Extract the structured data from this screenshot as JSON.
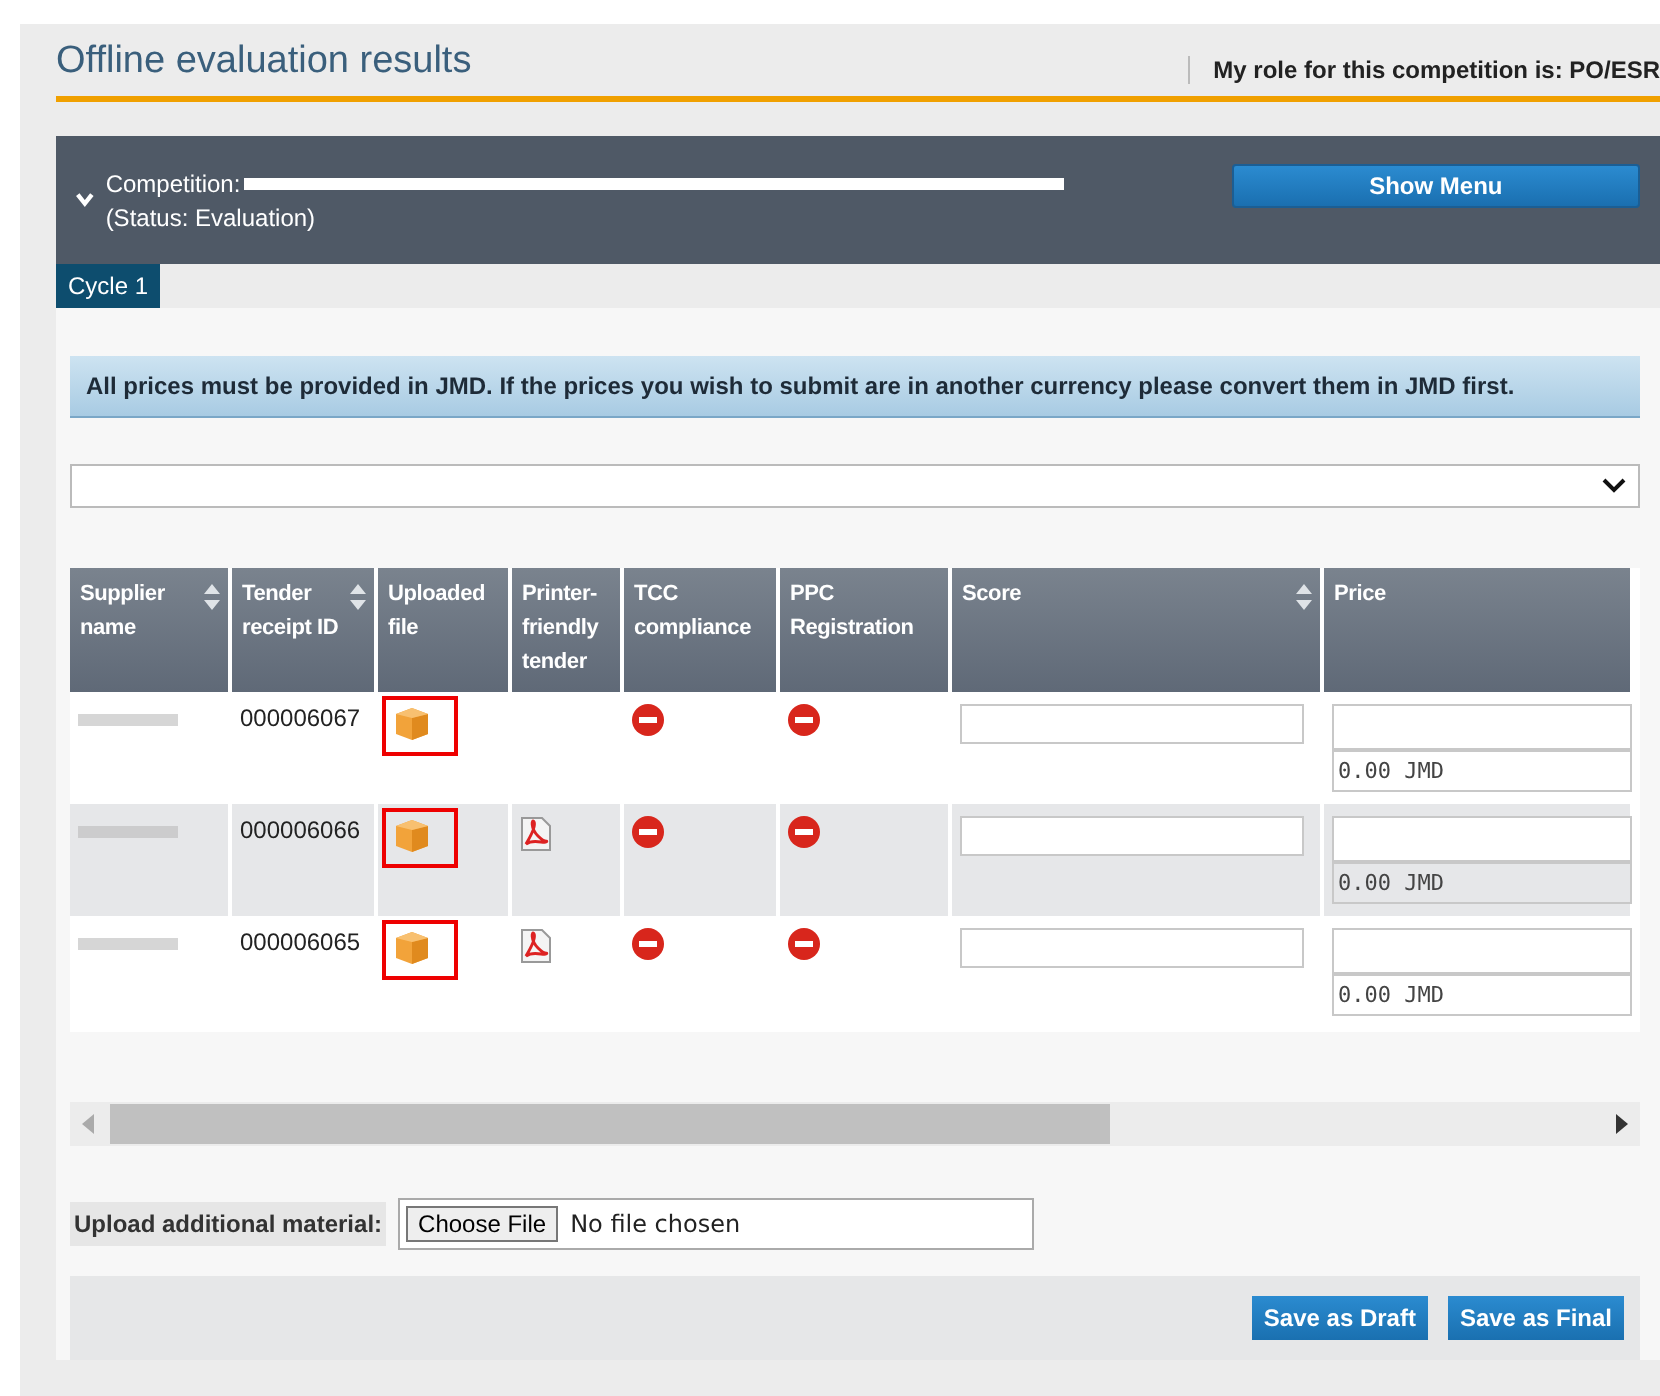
{
  "page": {
    "title": "Offline evaluation results",
    "role": "My role for this competition is: PO/ESR"
  },
  "competition": {
    "label": "Competition:",
    "status": "(Status: Evaluation)",
    "menu_button": "Show Menu",
    "expanded": true
  },
  "tabs": [
    {
      "label": "Cycle 1",
      "selected": true
    }
  ],
  "notice": "All prices must be provided in JMD. If the prices you wish to submit are in another currency please convert them in JMD first.",
  "table": {
    "columns": [
      {
        "label": "Supplier name",
        "sortable": true
      },
      {
        "label": "Tender receipt ID",
        "sortable": true
      },
      {
        "label": "Uploaded file",
        "sortable": false
      },
      {
        "label": "Printer-friendly tender",
        "sortable": false
      },
      {
        "label": "TCC compliance",
        "sortable": false
      },
      {
        "label": "PPC Registration",
        "sortable": false
      },
      {
        "label": "Score",
        "sortable": true
      },
      {
        "label": "Price",
        "sortable": false
      }
    ],
    "rows": [
      {
        "tender_id": "000006067",
        "highlighted": true,
        "has_pdf": false,
        "price_note": "0.00 JMD"
      },
      {
        "tender_id": "000006066",
        "highlighted": true,
        "has_pdf": true,
        "price_note": "0.00 JMD"
      },
      {
        "tender_id": "000006065",
        "highlighted": true,
        "has_pdf": true,
        "price_note": "0.00 JMD"
      }
    ]
  },
  "upload": {
    "label": "Upload additional material:",
    "button": "Choose File",
    "value": "No file chosen"
  },
  "buttons": [
    "Save as Draft",
    "Save as Final"
  ]
}
